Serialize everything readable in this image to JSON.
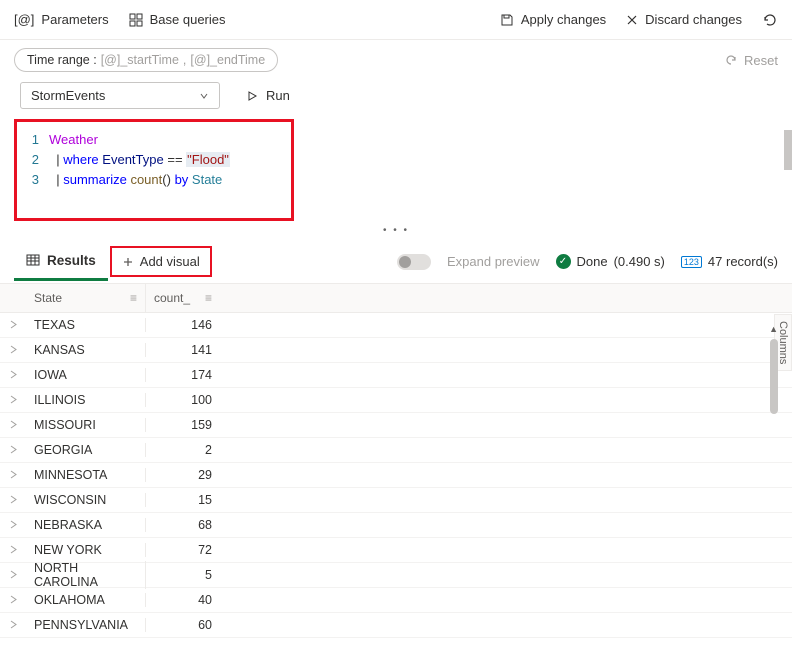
{
  "toolbar": {
    "parameters_label": "Parameters",
    "base_queries_label": "Base queries",
    "apply_label": "Apply changes",
    "discard_label": "Discard changes"
  },
  "time_range": {
    "prefix": "Time range :",
    "start": "[@]_startTime",
    "sep": ",",
    "end": "[@]_endTime"
  },
  "reset_label": "Reset",
  "query": {
    "db_name": "StormEvents",
    "run_label": "Run",
    "lines": {
      "l1_table": "Weather",
      "l2_pipe": "|",
      "l2_kw": "where",
      "l2_col": "EventType",
      "l2_op": "==",
      "l2_str": "\"Flood\"",
      "l3_pipe": "|",
      "l3_kw": "summarize",
      "l3_fn": "count",
      "l3_paren": "()",
      "l3_by": "by",
      "l3_col": "State"
    }
  },
  "tabs": {
    "results_label": "Results",
    "add_visual_label": "Add visual",
    "expand_label": "Expand preview",
    "status_label": "Done",
    "status_time": "(0.490 s)",
    "records_label": "47 record(s)",
    "records_badge": "123"
  },
  "columns_sidebar": "Columns",
  "grid": {
    "headers": {
      "state": "State",
      "count": "count_"
    },
    "rows": [
      {
        "state": "TEXAS",
        "count": 146
      },
      {
        "state": "KANSAS",
        "count": 141
      },
      {
        "state": "IOWA",
        "count": 174
      },
      {
        "state": "ILLINOIS",
        "count": 100
      },
      {
        "state": "MISSOURI",
        "count": 159
      },
      {
        "state": "GEORGIA",
        "count": 2
      },
      {
        "state": "MINNESOTA",
        "count": 29
      },
      {
        "state": "WISCONSIN",
        "count": 15
      },
      {
        "state": "NEBRASKA",
        "count": 68
      },
      {
        "state": "NEW YORK",
        "count": 72
      },
      {
        "state": "NORTH CAROLINA",
        "count": 5
      },
      {
        "state": "OKLAHOMA",
        "count": 40
      },
      {
        "state": "PENNSYLVANIA",
        "count": 60
      }
    ]
  }
}
